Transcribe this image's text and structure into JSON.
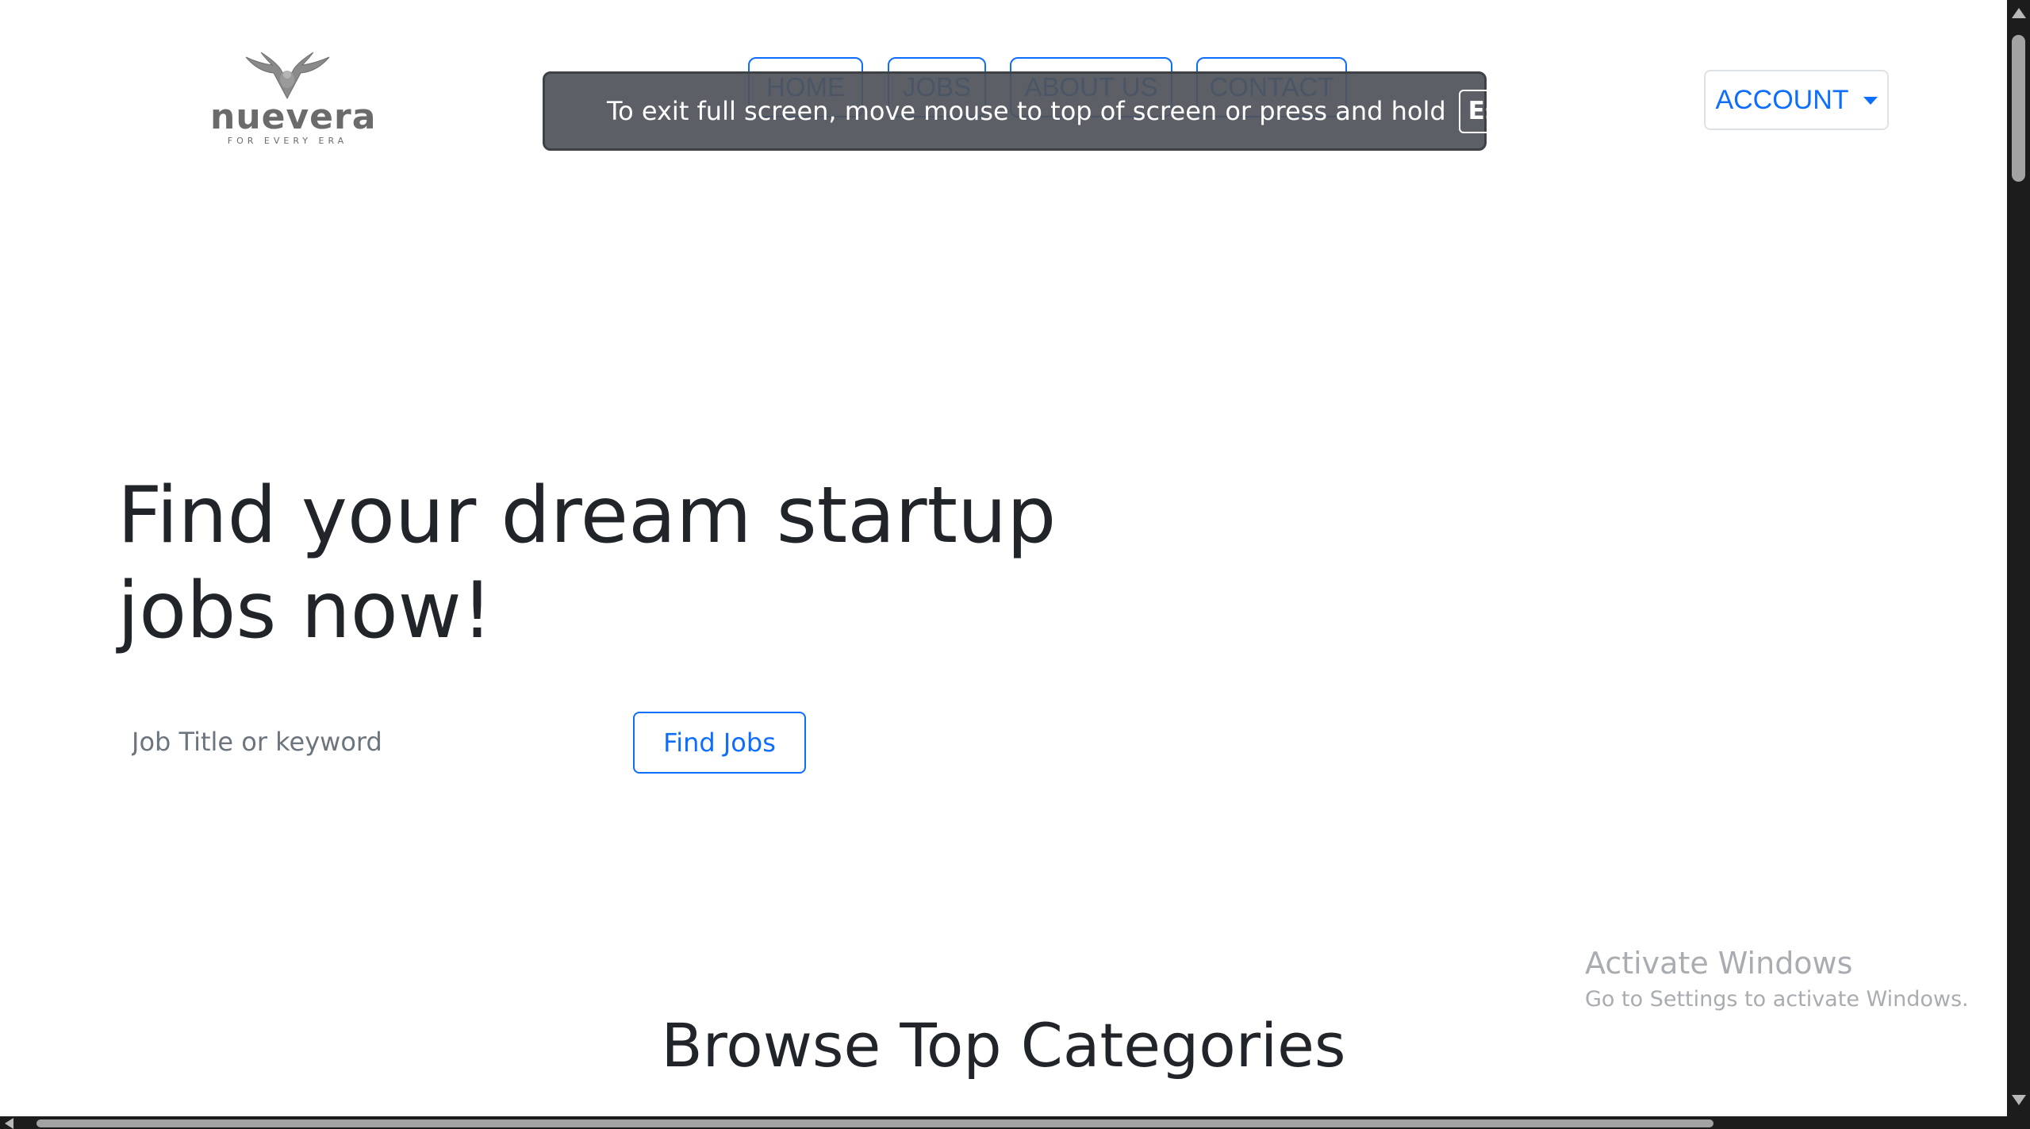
{
  "logo": {
    "wordmark": "nuevera",
    "tagline": "FOR EVERY ERA"
  },
  "nav": {
    "items": [
      {
        "label": "HOME"
      },
      {
        "label": "JOBS"
      },
      {
        "label": "ABOUT US"
      },
      {
        "label": "CONTACT"
      }
    ]
  },
  "account": {
    "label": "ACCOUNT"
  },
  "fullscreen_notice": {
    "message": "To exit full screen, move mouse to top of screen or press and hold",
    "key": "Esc"
  },
  "hero": {
    "title": "Find your dream startup jobs now!",
    "search_placeholder": "Job Title or keyword",
    "search_value": "",
    "button_label": "Find Jobs"
  },
  "categories": {
    "title": "Browse Top Categories"
  },
  "watermark": {
    "title": "Activate Windows",
    "subtitle": "Go to Settings to activate Windows."
  },
  "colors": {
    "accent": "#0d6efd",
    "text": "#212529",
    "overlay": "#50545a"
  }
}
